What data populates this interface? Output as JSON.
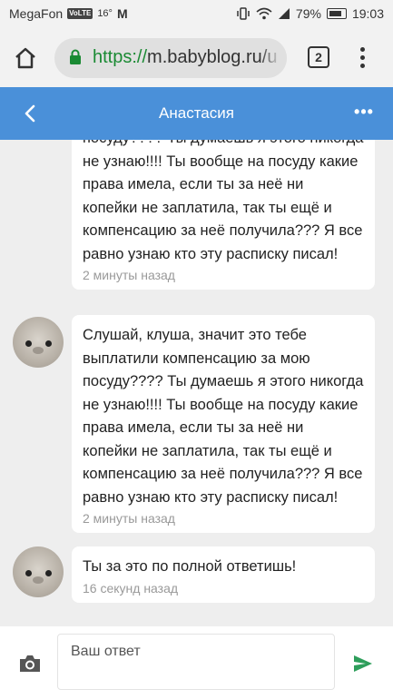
{
  "status_bar": {
    "carrier": "MegaFon",
    "volte": "VoLTE",
    "temperature": "16°",
    "app_letter": "M",
    "battery": "79%",
    "time": "19:03"
  },
  "browser": {
    "url_scheme": "https://",
    "url_host": "m.babyblog.ru/u",
    "tab_count": "2"
  },
  "app_header": {
    "title": "Анастасия"
  },
  "messages": [
    {
      "text": "посуду???? Ты думаешь я этого никогда\nне узнаю!!!! Ты вообще на посуду какие\nправа имела, если ты за неё ни\nкопейки не заплатила, так ты ещё и\nкомпенсацию за неё получила??? Я все\nравно узнаю кто эту расписку писал!",
      "time": "2 минуты назад"
    },
    {
      "text": "Слушай, клуша, значит это тебе\nвыплатили компенсацию за мою\nпосуду???? Ты думаешь я этого никогда\nне узнаю!!!! Ты вообще на посуду какие\nправа имела, если ты за неё ни\nкопейки не заплатила, так ты ещё и\nкомпенсацию за неё получила??? Я все\nравно узнаю кто эту расписку писал!",
      "time": "2 минуты назад"
    },
    {
      "text": "Ты за это по полной ответишь!",
      "time": "16 секунд назад"
    }
  ],
  "composer": {
    "placeholder": "Ваш ответ"
  },
  "colors": {
    "app_bar": "#4a90d9",
    "send": "#2e9e5b",
    "secure": "#1a8a33"
  },
  "icons": [
    "home-icon",
    "lock-icon",
    "tabs-icon",
    "overflow-menu-icon",
    "back-chevron-icon",
    "more-dots-icon",
    "camera-icon",
    "send-icon"
  ]
}
